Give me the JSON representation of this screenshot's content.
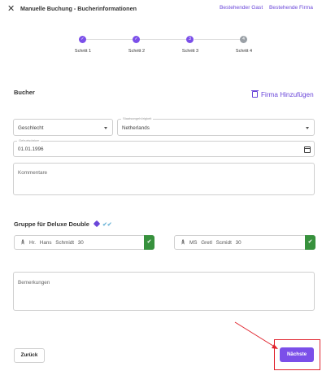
{
  "header": {
    "title": "Manuelle Buchung - Bucherinformationen",
    "link_existing_guest": "Bestehender Gast",
    "link_existing_company": "Bestehende Firma"
  },
  "stepper": {
    "steps": [
      {
        "label": "Schritt 1",
        "mark": "✓",
        "state": "done"
      },
      {
        "label": "Schritt 2",
        "mark": "✓",
        "state": "done"
      },
      {
        "label": "Schritt 3",
        "mark": "3",
        "state": "active"
      },
      {
        "label": "Schritt 4",
        "mark": "4",
        "state": "todo"
      }
    ]
  },
  "booker": {
    "section_title": "Bucher",
    "add_company_label": "Firma Hinzufügen",
    "gender": {
      "value": "Geschlecht"
    },
    "nationality": {
      "label": "Staatsangehörigkeit",
      "value": "Netherlands"
    },
    "birthdate": {
      "label": "Geburtsdatum",
      "value": "01.01.1996"
    },
    "comment": {
      "placeholder": "Kommentare"
    }
  },
  "group": {
    "section_title": "Gruppe für Deluxe Double",
    "guests": [
      {
        "text": "Hr.  Hans  Schmidt  30"
      },
      {
        "text": "MS  Gretl  Scmidt  30"
      }
    ]
  },
  "remarks": {
    "placeholder": "Bemerkungen"
  },
  "footer": {
    "back_label": "Zurück",
    "next_label": "Nächste"
  },
  "colors": {
    "accent": "#7b4fe9",
    "link": "#6a46d9",
    "confirm": "#37913d",
    "highlight": "#e0232d"
  }
}
